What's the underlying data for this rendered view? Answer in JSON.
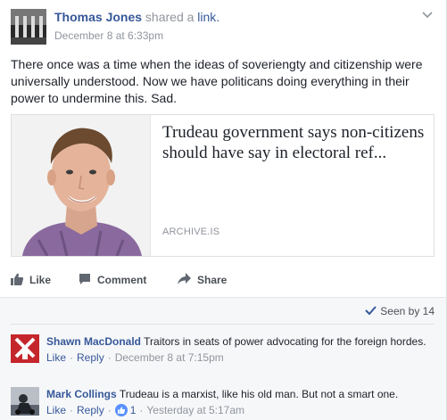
{
  "post": {
    "author_name": "Thomas Jones",
    "action_text": "shared a",
    "action_link": "link.",
    "timestamp": "December 8 at 6:33pm",
    "text": "There once was a time when the ideas of soveriengty and citizenship were universally understood. Now we have politicans doing everything in their power to undermine this. Sad."
  },
  "link_card": {
    "title": "Trudeau government says non-citizens should have say in electoral ref...",
    "domain": "ARCHIVE.IS"
  },
  "actions": {
    "like": "Like",
    "comment": "Comment",
    "share": "Share"
  },
  "seen_by": "Seen by 14",
  "comments": [
    {
      "author": "Shawn MacDonald",
      "text": "Traitors in seats of power advocating for the foreign hordes.",
      "like": "Like",
      "reply": "Reply",
      "time": "December 8 at 7:15pm"
    },
    {
      "author": "Mark Collings",
      "text": "Trudeau is a marxist, like his old man. But not a smart one.",
      "like": "Like",
      "reply": "Reply",
      "reactions": "1",
      "time": "Yesterday at 5:17am"
    }
  ],
  "colors": {
    "link": "#365899",
    "meta": "#90949c",
    "text": "#1d2129",
    "comment_bg": "#f6f7f9",
    "like_badge": "#5890ff",
    "avatar_red": "#c4262b"
  },
  "icons": {
    "like": "thumbs-up-icon",
    "comment": "speech-bubble-icon",
    "share": "share-arrow-icon",
    "seen": "checkmark-icon",
    "options": "chevron-down-icon"
  }
}
